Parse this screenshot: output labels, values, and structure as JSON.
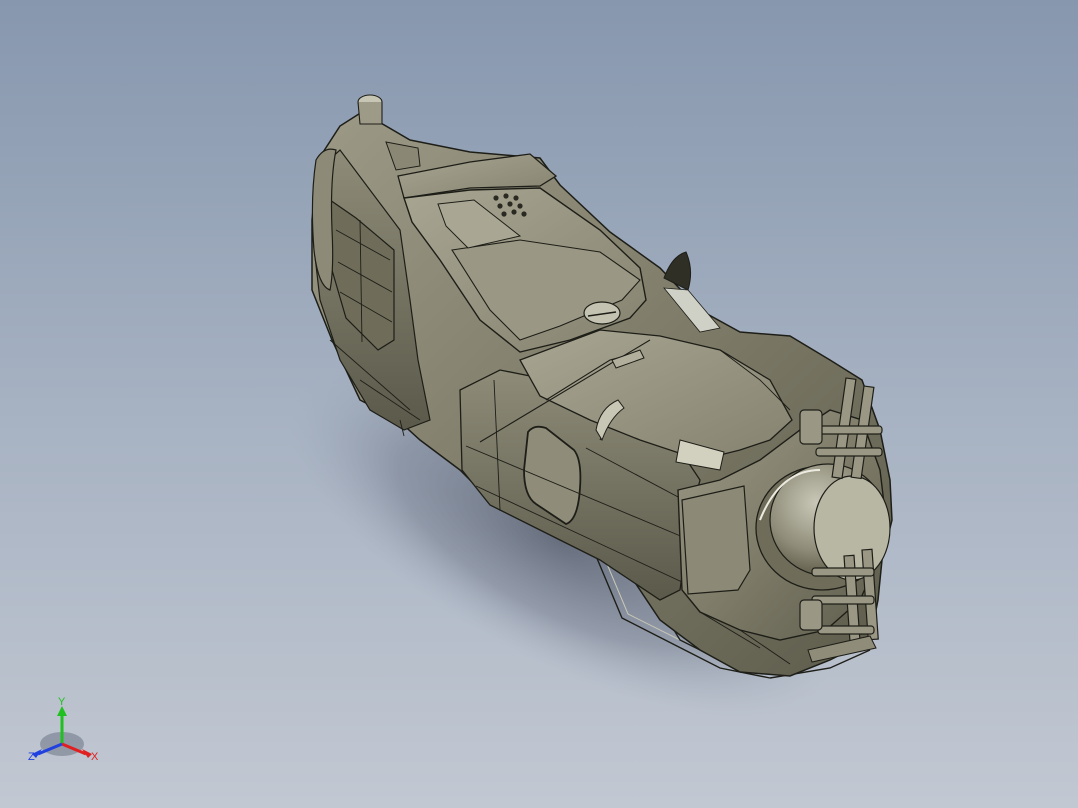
{
  "viewport": {
    "background_top": "#8797ae",
    "background_bottom": "#c2c8d2",
    "model_color": "#7e7c68",
    "edge_color": "#1e1e18"
  },
  "triad": {
    "x_label": "X",
    "y_label": "Y",
    "z_label": "Z",
    "x_color": "#e02020",
    "y_color": "#20c020",
    "z_color": "#2040e0"
  }
}
